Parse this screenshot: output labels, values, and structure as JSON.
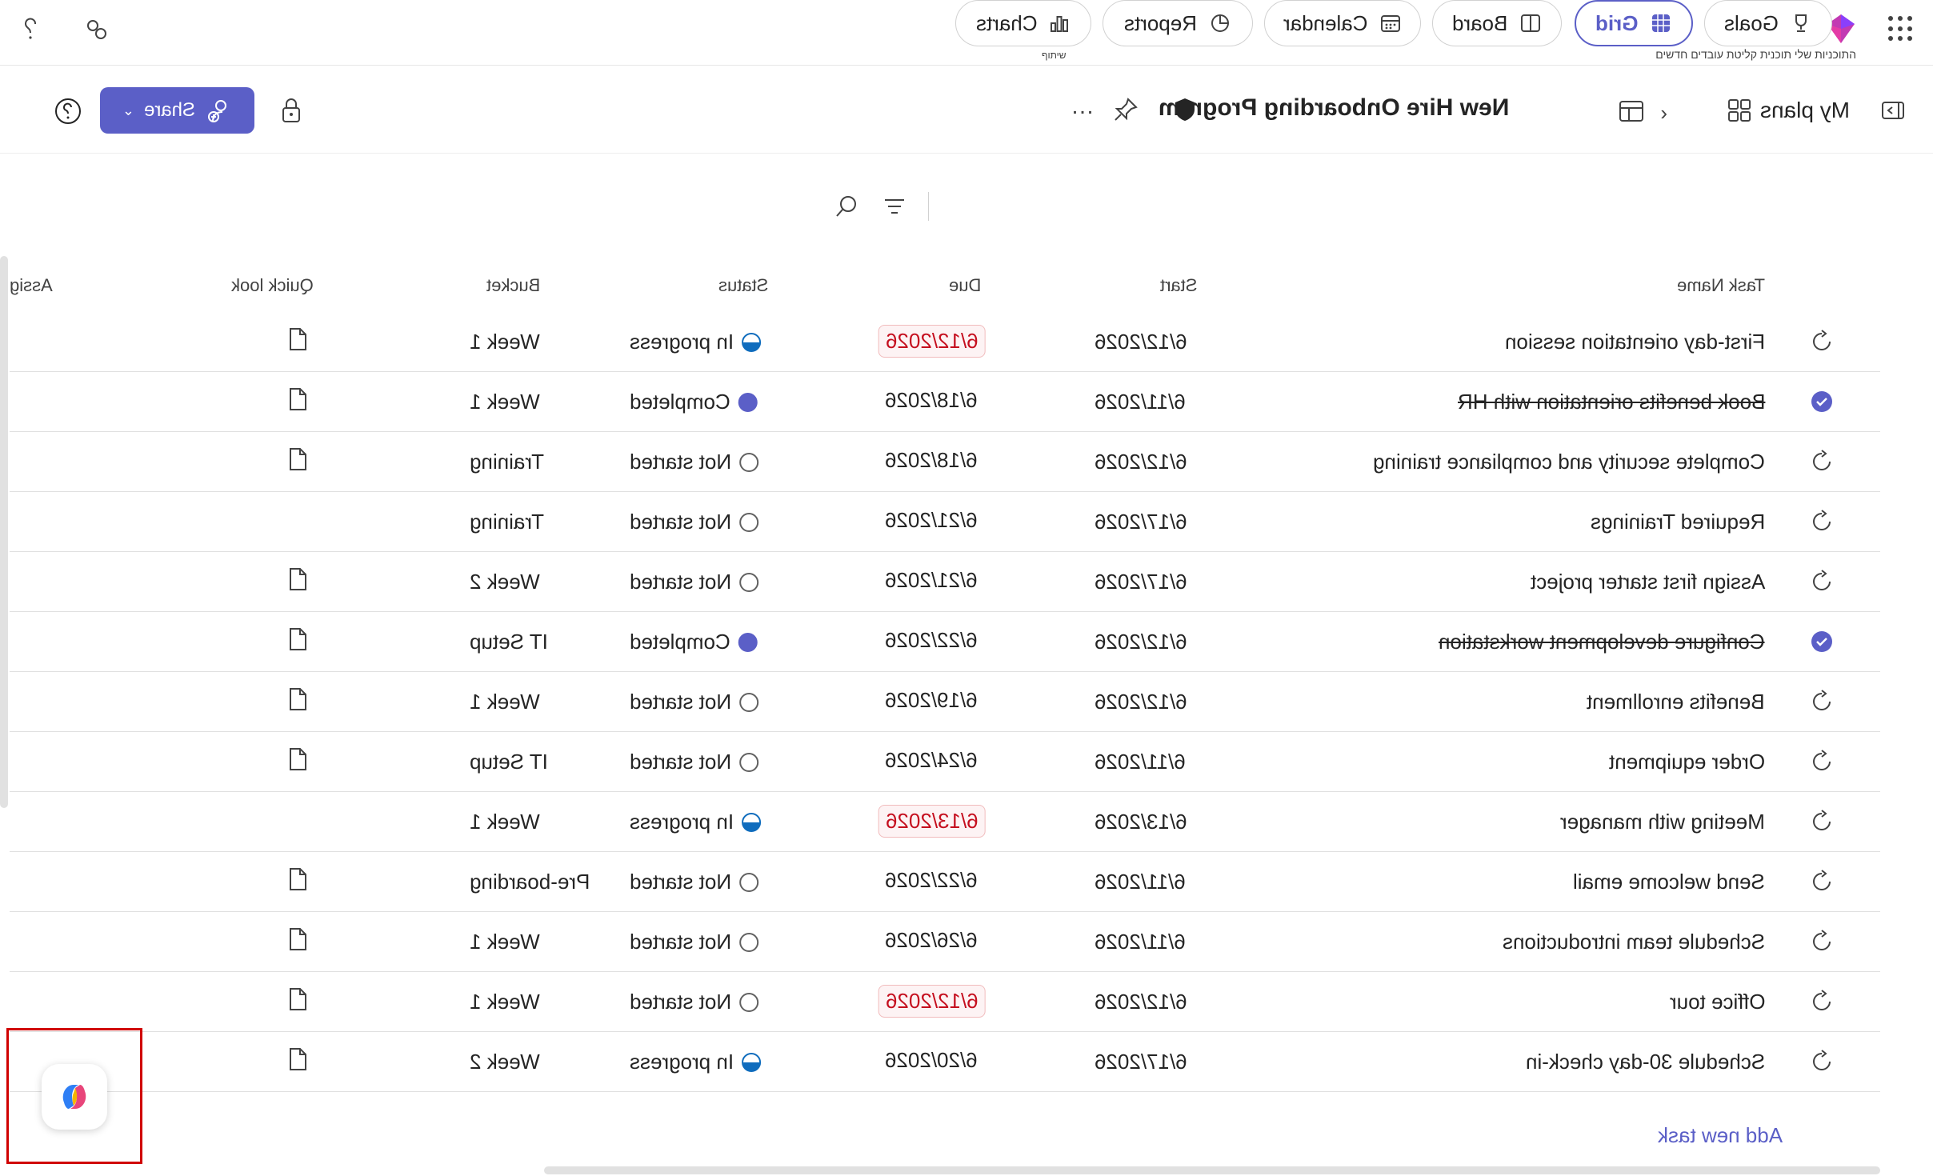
{
  "app": {
    "breadcrumb": [
      "התוכניות שלי",
      "תוכנית קליטת עובדים חדשים"
    ],
    "share_hint": "שיתוף"
  },
  "plan": {
    "my_plans_label": "My plans",
    "title": "New Hire Onboarding Program",
    "share_label": "Share"
  },
  "tabs": [
    {
      "label": "Goals",
      "icon": "trophy-icon"
    },
    {
      "label": "Grid",
      "icon": "grid-icon",
      "active": true
    },
    {
      "label": "Board",
      "icon": "board-icon"
    },
    {
      "label": "Calendar",
      "icon": "calendar-icon"
    },
    {
      "label": "Reports",
      "icon": "reports-icon"
    },
    {
      "label": "Charts",
      "icon": "charts-icon"
    }
  ],
  "columns": {
    "task_name": "Task Name",
    "start": "Start",
    "due": "Due",
    "status": "Status",
    "bucket": "Bucket",
    "quick_look": "Quick look",
    "assigned": "Assig"
  },
  "rows": [
    {
      "name": "First-day orientation session",
      "start": "6/12/2026",
      "due": "6/12/2026",
      "due_late": true,
      "status": "In progress",
      "status_kind": "prog",
      "bucket": "Week 1",
      "quick": true
    },
    {
      "name": "Book benefits orientation with HR",
      "start": "6/11/2026",
      "due": "6/18/2026",
      "due_late": false,
      "status": "Completed",
      "status_kind": "done",
      "bucket": "Week 1",
      "quick": true
    },
    {
      "name": "Complete security and compliance training",
      "start": "6/12/2026",
      "due": "6/18/2026",
      "due_late": false,
      "status": "Not started",
      "status_kind": "none",
      "bucket": "Training",
      "quick": true
    },
    {
      "name": "Required Trainings",
      "start": "6/17/2026",
      "due": "6/21/2026",
      "due_late": false,
      "status": "Not started",
      "status_kind": "none",
      "bucket": "Training",
      "quick": false
    },
    {
      "name": "Assign first starter project",
      "start": "6/17/2026",
      "due": "6/21/2026",
      "due_late": false,
      "status": "Not started",
      "status_kind": "none",
      "bucket": "Week 2",
      "quick": true
    },
    {
      "name": "Configure development workstation",
      "start": "6/12/2026",
      "due": "6/22/2026",
      "due_late": false,
      "status": "Completed",
      "status_kind": "done",
      "bucket": "IT Setup",
      "quick": true
    },
    {
      "name": "Benefits enrollment",
      "start": "6/12/2026",
      "due": "6/19/2026",
      "due_late": false,
      "status": "Not started",
      "status_kind": "none",
      "bucket": "Week 1",
      "quick": true
    },
    {
      "name": "Order equipment",
      "start": "6/11/2026",
      "due": "6/24/2026",
      "due_late": false,
      "status": "Not started",
      "status_kind": "none",
      "bucket": "IT Setup",
      "quick": true
    },
    {
      "name": "Meeting with manager",
      "start": "6/13/2026",
      "due": "6/13/2026",
      "due_late": true,
      "status": "In progress",
      "status_kind": "prog",
      "bucket": "Week 1",
      "quick": false
    },
    {
      "name": "Send welcome email",
      "start": "6/11/2026",
      "due": "6/22/2026",
      "due_late": false,
      "status": "Not started",
      "status_kind": "none",
      "bucket": "Pre-boarding",
      "quick": true
    },
    {
      "name": "Schedule team introductions",
      "start": "6/11/2026",
      "due": "6/26/2026",
      "due_late": false,
      "status": "Not started",
      "status_kind": "none",
      "bucket": "Week 1",
      "quick": true
    },
    {
      "name": "Office tour",
      "start": "6/12/2026",
      "due": "6/12/2026",
      "due_late": true,
      "status": "Not started",
      "status_kind": "none",
      "bucket": "Week 1",
      "quick": true
    },
    {
      "name": "Schedule 30-day check-in",
      "start": "6/17/2026",
      "due": "6/20/2026",
      "due_late": false,
      "status": "In progress",
      "status_kind": "prog",
      "bucket": "Week 2",
      "quick": true
    }
  ],
  "add_task_label": "Add new task",
  "colors": {
    "accent": "#5b5fc7",
    "late": "#c50f1f",
    "progress": "#0f6cbd"
  }
}
